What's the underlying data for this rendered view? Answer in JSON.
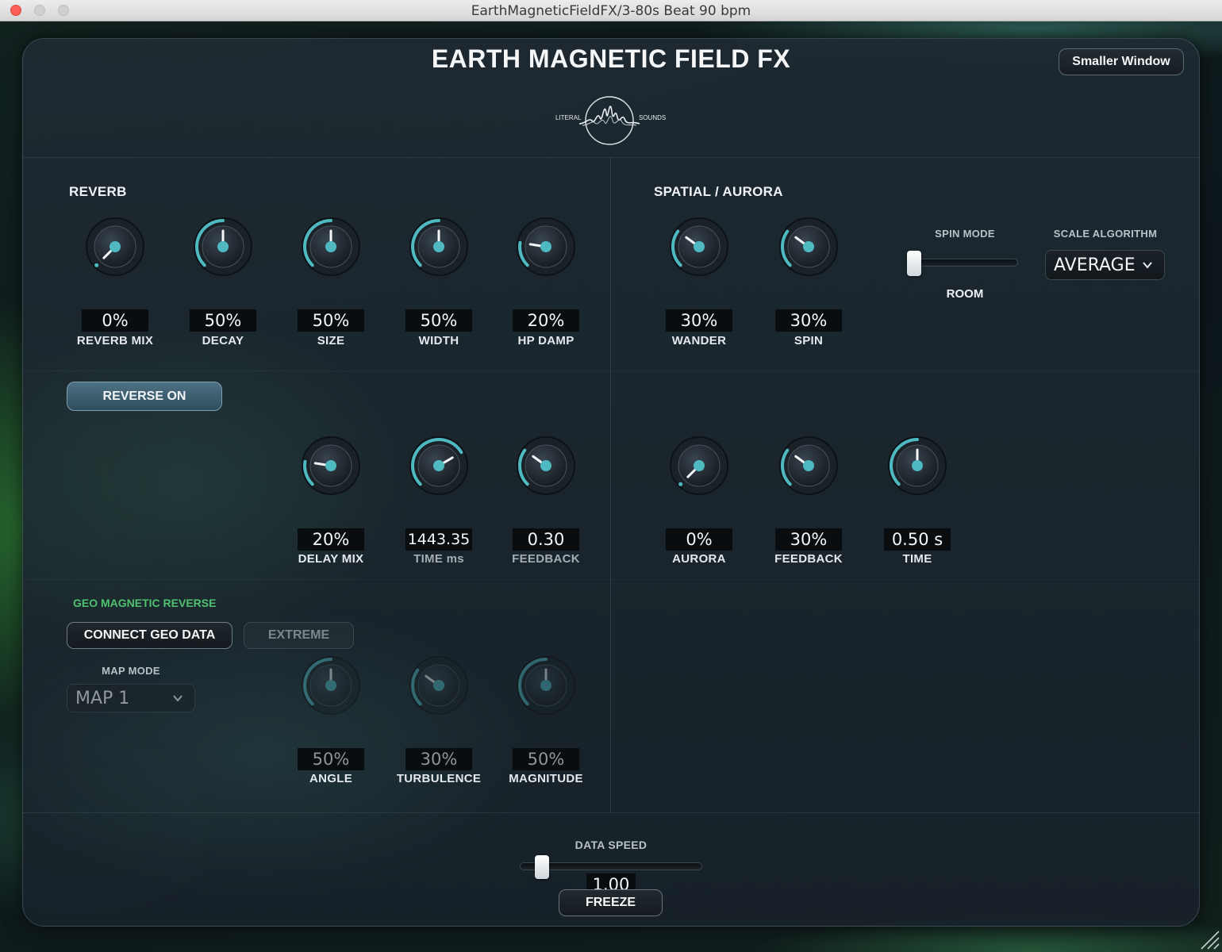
{
  "window": {
    "title": "EarthMagneticFieldFX/3-80s Beat 90 bpm"
  },
  "header": {
    "title": "EARTH MAGNETIC FIELD FX",
    "smaller_window": "Smaller Window",
    "logo": {
      "left_text": "LITERAL",
      "right_text": "SOUNDS"
    }
  },
  "reverb": {
    "title": "REVERB",
    "knobs": [
      {
        "label": "REVERB MIX",
        "value": "0%",
        "level": 0.0
      },
      {
        "label": "DECAY",
        "value": "50%",
        "level": 0.5
      },
      {
        "label": "SIZE",
        "value": "50%",
        "level": 0.5
      },
      {
        "label": "WIDTH",
        "value": "50%",
        "level": 0.5
      },
      {
        "label": "HP DAMP",
        "value": "20%",
        "level": 0.2
      }
    ]
  },
  "delay": {
    "reverse_button": "REVERSE ON",
    "knobs": [
      {
        "label": "DELAY MIX",
        "value": "20%",
        "level": 0.2
      },
      {
        "label": "TIME ms",
        "value": "1443.35",
        "level": 0.72
      },
      {
        "label": "FEEDBACK",
        "value": "0.30",
        "level": 0.3
      }
    ]
  },
  "geo": {
    "title": "GEO MAGNETIC REVERSE",
    "connect_button": "CONNECT GEO DATA",
    "extreme_button": "EXTREME",
    "map_mode_label": "MAP MODE",
    "map_mode_value": "MAP 1",
    "knobs": [
      {
        "label": "ANGLE",
        "value": "50%",
        "level": 0.5
      },
      {
        "label": "TURBULENCE",
        "value": "30%",
        "level": 0.3
      },
      {
        "label": "MAGNITUDE",
        "value": "50%",
        "level": 0.5
      }
    ]
  },
  "spatial": {
    "title": "SPATIAL / AURORA",
    "knobs": [
      {
        "label": "WANDER",
        "value": "30%",
        "level": 0.3
      },
      {
        "label": "SPIN",
        "value": "30%",
        "level": 0.3
      }
    ],
    "spin_mode_label": "SPIN MODE",
    "spin_mode_value": "ROOM",
    "spin_mode_level": 0.0,
    "scale_algorithm_label": "SCALE ALGORITHM",
    "scale_algorithm_value": "AVERAGE"
  },
  "aurora": {
    "knobs": [
      {
        "label": "AURORA",
        "value": "0%",
        "level": 0.0
      },
      {
        "label": "FEEDBACK",
        "value": "30%",
        "level": 0.3
      },
      {
        "label": "TIME",
        "value": "0.50 s",
        "level": 0.5
      }
    ]
  },
  "footer": {
    "data_speed_label": "DATA SPEED",
    "data_speed_value": "1.00",
    "data_speed_level": 0.08,
    "freeze_button": "FREEZE"
  },
  "colors": {
    "accent": "#4fb9c2",
    "geo_green": "#4fc070",
    "panel": "#1e2a32"
  },
  "icons": [
    "chevron-down-icon",
    "literal-sounds-logo",
    "resize-grip-icon"
  ]
}
